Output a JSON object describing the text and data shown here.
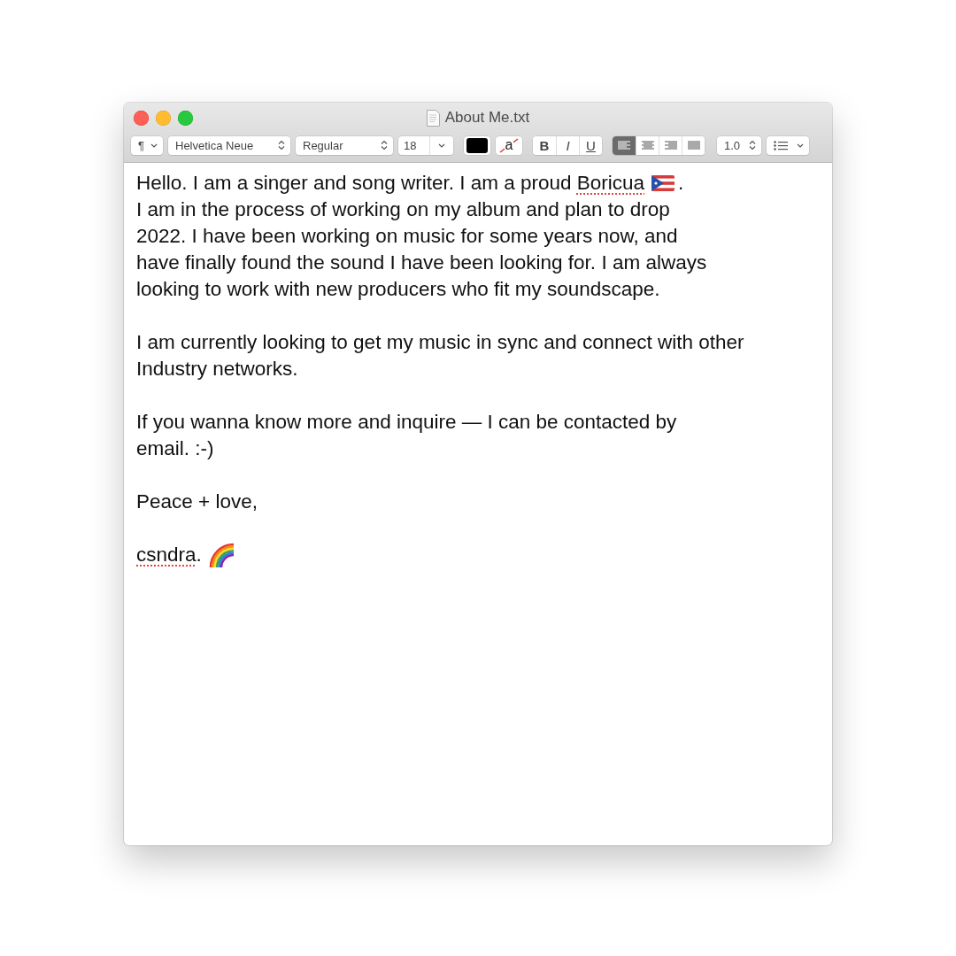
{
  "window": {
    "title": "About Me.txt"
  },
  "toolbar": {
    "paragraph_style": "¶",
    "font_family": "Helvetica Neue",
    "font_style": "Regular",
    "font_size": "18",
    "text_color_well": {
      "color": "#000000"
    },
    "background_color_glyph": "a",
    "style_buttons": [
      {
        "label": "B",
        "kind": "bold",
        "on": false
      },
      {
        "label": "I",
        "kind": "italic",
        "on": false
      },
      {
        "label": "U",
        "kind": "underline",
        "on": false
      }
    ],
    "alignment": [
      {
        "kind": "left",
        "selected": true
      },
      {
        "kind": "center",
        "selected": false
      },
      {
        "kind": "right",
        "selected": false
      },
      {
        "kind": "justify",
        "selected": false
      }
    ],
    "line_spacing": "1.0"
  },
  "document": {
    "paragraphs": [
      [
        {
          "segments": [
            {
              "kind": "text",
              "text": "Hello. I am a singer and song writer. I am a proud "
            },
            {
              "kind": "misspelled",
              "text": "Boricua"
            },
            {
              "kind": "flag"
            },
            {
              "kind": "text",
              "text": "."
            }
          ]
        },
        {
          "segments": [
            {
              "kind": "text",
              "text": "I am in the process of working on my album and plan to drop"
            }
          ]
        },
        {
          "segments": [
            {
              "kind": "text",
              "text": "2022. I have been working on music for some years now, and"
            }
          ]
        },
        {
          "segments": [
            {
              "kind": "text",
              "text": "have finally found the sound I have been looking for. I am always"
            }
          ]
        },
        {
          "segments": [
            {
              "kind": "text",
              "text": "looking to work with new producers who fit my soundscape."
            }
          ]
        }
      ],
      [
        {
          "segments": [
            {
              "kind": "text",
              "text": "I am currently looking to get my music in sync and connect with other"
            }
          ]
        },
        {
          "segments": [
            {
              "kind": "text",
              "text": "Industry networks."
            }
          ]
        }
      ],
      [
        {
          "segments": [
            {
              "kind": "text",
              "text": "If you wanna know more and inquire — I can be contacted by"
            }
          ]
        },
        {
          "segments": [
            {
              "kind": "text",
              "text": "email. :-)"
            }
          ]
        }
      ],
      [
        {
          "segments": [
            {
              "kind": "text",
              "text": "Peace + love,"
            }
          ]
        }
      ],
      [
        {
          "segments": [
            {
              "kind": "misspelled",
              "text": "csndra"
            },
            {
              "kind": "text",
              "text": "."
            },
            {
              "kind": "rainbow"
            }
          ]
        }
      ]
    ]
  }
}
